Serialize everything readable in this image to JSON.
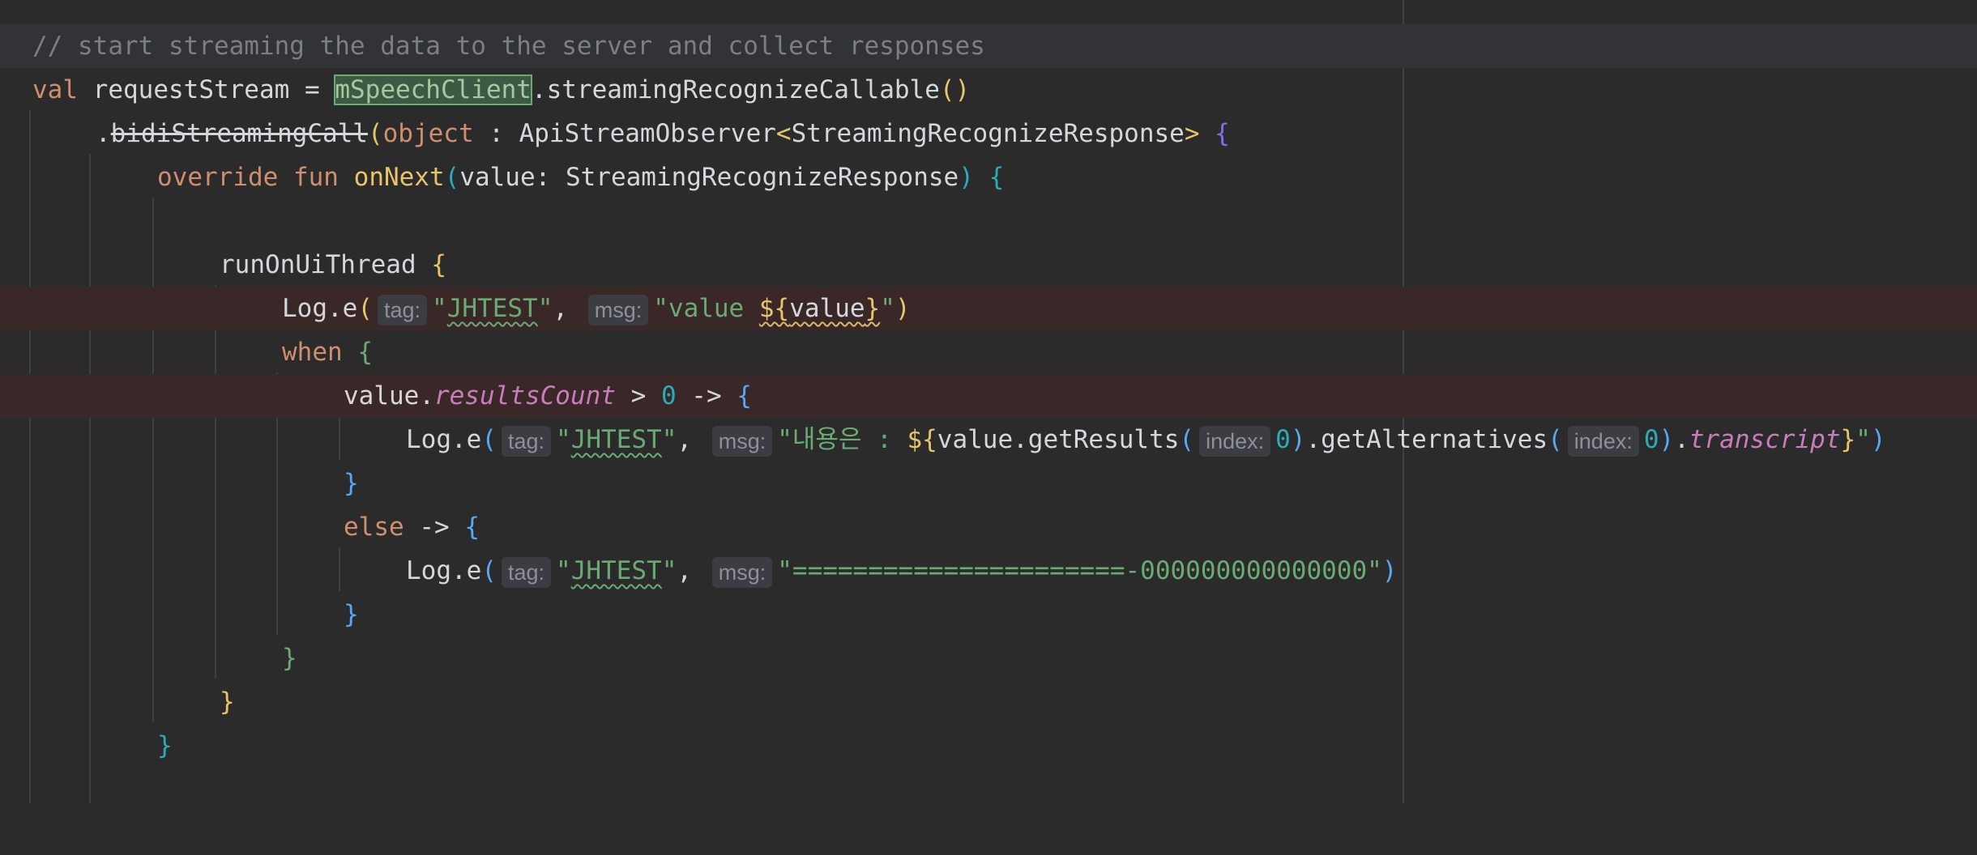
{
  "editor": {
    "lines": {
      "comment": "// start streaming the data to the server and collect responses",
      "val_kw": "val",
      "request_stream": "requestStream",
      "equals": "=",
      "speech_client": "mSpeechClient",
      "streaming_callable": ".streamingRecognizeCallable",
      "callable_parens": "()",
      "dot": ".",
      "bidi_call": "bidiStreamingCall",
      "open_paren": "(",
      "object_kw": "object",
      "colon_sep": " : ",
      "api_observer": "ApiStreamObserver",
      "generic_open": "<",
      "response_type": "StreamingRecognizeResponse",
      "generic_close": ">",
      "open_brace": "{",
      "override_kw": "override",
      "fun_kw": "fun",
      "on_next": "onNext",
      "param": "value: StreamingRecognizeResponse",
      "run_on_ui": "runOnUiThread",
      "log_e": "Log.e",
      "tag_hint": "tag:",
      "msg_hint": "msg:",
      "index_hint": "index:",
      "jhtest": "JHTEST",
      "quote": "\"",
      "comma": ",",
      "value_prefix": "value ",
      "tmpl_open": "${",
      "tmpl_value": "value",
      "tmpl_close": "}",
      "close_paren": ")",
      "when_kw": "when",
      "value_dot": "value.",
      "results_count": "resultsCount",
      "gt_zero_arrow": " > ",
      "zero": "0",
      "arrow": " -> ",
      "korean_msg": "내용은 : ",
      "get_results": "value.getResults",
      "get_alternatives": ".getAlternatives",
      "transcript": "transcript",
      "close_brace": "}",
      "else_kw": "else",
      "equals_msg": "======================-000000000000000"
    }
  },
  "colors": {
    "background": "#2b2b2b",
    "current_line": "#323337",
    "error_line": "#3a2727",
    "keyword": "#cf8e6d",
    "string": "#6aab73",
    "number": "#2aacb8",
    "function_call": "#56a8f5",
    "function_declaration": "#e7c46a",
    "property": "#c77dbb",
    "comment": "#7a7e85"
  }
}
